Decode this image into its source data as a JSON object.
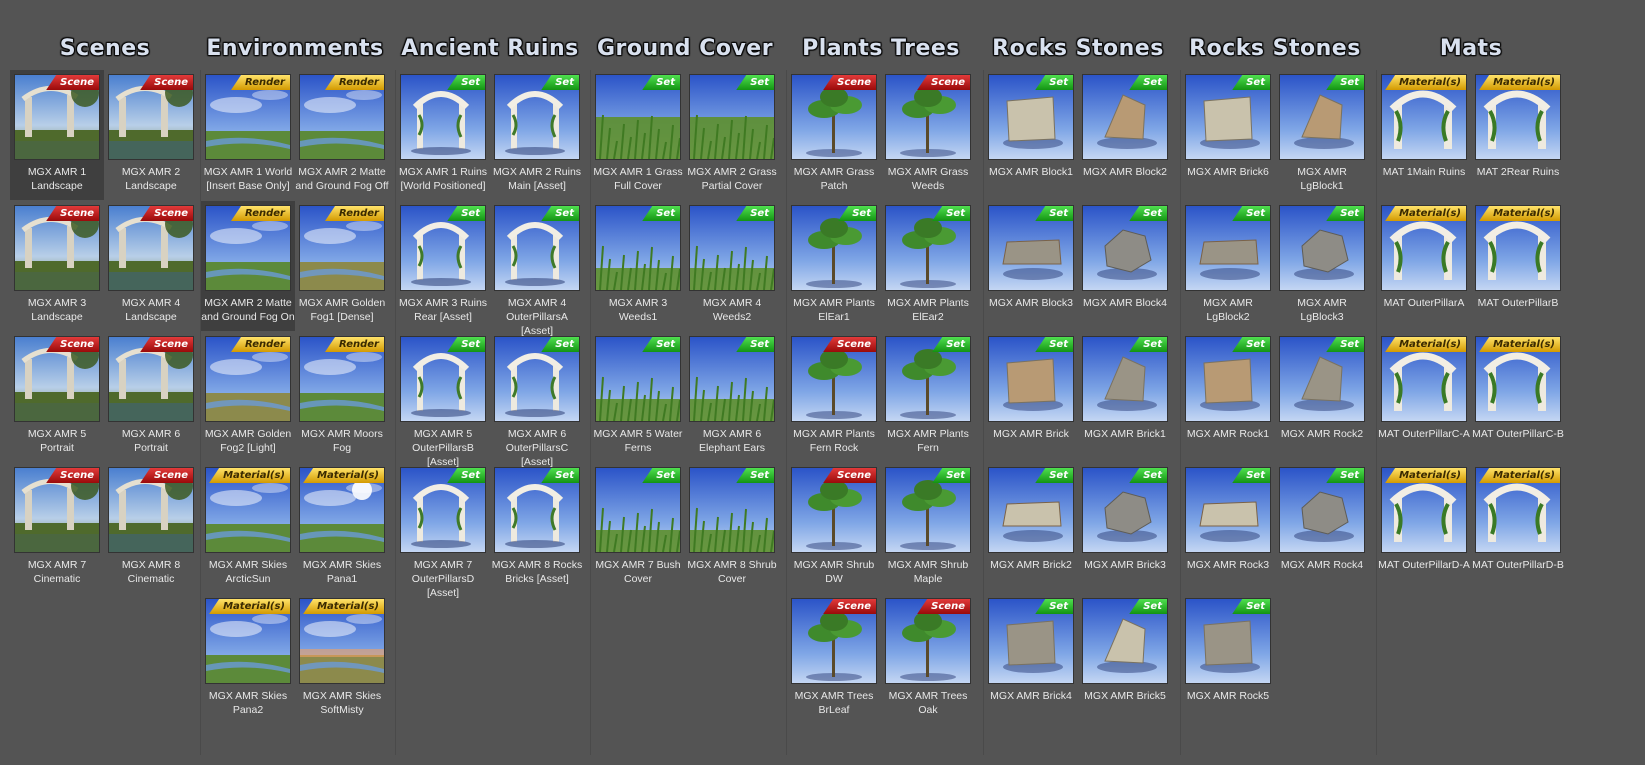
{
  "columns": [
    {
      "title": "Scenes",
      "items": [
        {
          "label": "MGX AMR 1 Landscape",
          "badge": "Scene",
          "kind": "scene",
          "selected": true
        },
        {
          "label": "MGX AMR 2 Landscape",
          "badge": "Scene",
          "kind": "scene"
        },
        {
          "label": "MGX AMR 3 Landscape",
          "badge": "Scene",
          "kind": "scene"
        },
        {
          "label": "MGX AMR 4 Landscape",
          "badge": "Scene",
          "kind": "scene"
        },
        {
          "label": "MGX AMR 5 Portrait",
          "badge": "Scene",
          "kind": "scene"
        },
        {
          "label": "MGX AMR 6 Portrait",
          "badge": "Scene",
          "kind": "scene"
        },
        {
          "label": "MGX AMR 7 Cinematic",
          "badge": "Scene",
          "kind": "scene"
        },
        {
          "label": "MGX AMR 8 Cinematic",
          "badge": "Scene",
          "kind": "scene"
        }
      ]
    },
    {
      "title": "Environments",
      "items": [
        {
          "label": "MGX AMR 1 World [Insert Base Only]",
          "badge": "Render",
          "kind": "render"
        },
        {
          "label": "MGX AMR 2 Matte and Ground Fog Off",
          "badge": "Render",
          "kind": "render"
        },
        {
          "label": "MGX AMR 2 Matte and Ground Fog On",
          "badge": "Render",
          "kind": "render",
          "selected": true
        },
        {
          "label": "MGX AMR Golden Fog1 [Dense]",
          "badge": "Render",
          "kind": "render"
        },
        {
          "label": "MGX AMR Golden Fog2 [Light]",
          "badge": "Render",
          "kind": "render"
        },
        {
          "label": "MGX AMR Moors Fog",
          "badge": "Render",
          "kind": "render"
        },
        {
          "label": "MGX AMR Skies ArcticSun",
          "badge": "Material(s)",
          "kind": "mat"
        },
        {
          "label": "MGX AMR Skies Pana1",
          "badge": "Material(s)",
          "kind": "mat"
        },
        {
          "label": "MGX AMR Skies Pana2",
          "badge": "Material(s)",
          "kind": "mat"
        },
        {
          "label": "MGX AMR Skies SoftMisty",
          "badge": "Material(s)",
          "kind": "mat"
        }
      ]
    },
    {
      "title": "Ancient Ruins",
      "items": [
        {
          "label": "MGX AMR 1 Ruins [World Positioned]",
          "badge": "Set",
          "kind": "set"
        },
        {
          "label": "MGX AMR 2 Ruins Main [Asset]",
          "badge": "Set",
          "kind": "set"
        },
        {
          "label": "MGX AMR 3 Ruins Rear [Asset]",
          "badge": "Set",
          "kind": "set"
        },
        {
          "label": "MGX AMR 4 OuterPillarsA [Asset]",
          "badge": "Set",
          "kind": "set"
        },
        {
          "label": "MGX AMR 5 OuterPillarsB [Asset]",
          "badge": "Set",
          "kind": "set"
        },
        {
          "label": "MGX AMR 6 OuterPillarsC [Asset]",
          "badge": "Set",
          "kind": "set"
        },
        {
          "label": "MGX AMR 7 OuterPillarsD [Asset]",
          "badge": "Set",
          "kind": "set"
        },
        {
          "label": "MGX AMR 8 Rocks Bricks [Asset]",
          "badge": "Set",
          "kind": "set"
        }
      ]
    },
    {
      "title": "Ground Cover",
      "items": [
        {
          "label": "MGX AMR 1 Grass Full Cover",
          "badge": "Set",
          "kind": "set"
        },
        {
          "label": "MGX AMR 2 Grass Partial Cover",
          "badge": "Set",
          "kind": "set"
        },
        {
          "label": "MGX AMR 3 Weeds1",
          "badge": "Set",
          "kind": "set"
        },
        {
          "label": "MGX AMR 4 Weeds2",
          "badge": "Set",
          "kind": "set"
        },
        {
          "label": "MGX AMR 5 Water Ferns",
          "badge": "Set",
          "kind": "set"
        },
        {
          "label": "MGX AMR 6 Elephant Ears",
          "badge": "Set",
          "kind": "set"
        },
        {
          "label": "MGX AMR 7 Bush Cover",
          "badge": "Set",
          "kind": "set"
        },
        {
          "label": "MGX AMR 8 Shrub Cover",
          "badge": "Set",
          "kind": "set"
        }
      ]
    },
    {
      "title": "Plants Trees",
      "items": [
        {
          "label": "MGX AMR Grass Patch",
          "badge": "Scene",
          "kind": "scene"
        },
        {
          "label": "MGX AMR Grass Weeds",
          "badge": "Scene",
          "kind": "scene"
        },
        {
          "label": "MGX AMR Plants ElEar1",
          "badge": "Set",
          "kind": "set"
        },
        {
          "label": "MGX AMR Plants ElEar2",
          "badge": "Set",
          "kind": "set"
        },
        {
          "label": "MGX AMR Plants Fern Rock",
          "badge": "Scene",
          "kind": "scene"
        },
        {
          "label": "MGX AMR Plants Fern",
          "badge": "Set",
          "kind": "set"
        },
        {
          "label": "MGX AMR Shrub DW",
          "badge": "Scene",
          "kind": "scene"
        },
        {
          "label": "MGX AMR Shrub Maple",
          "badge": "Set",
          "kind": "set"
        },
        {
          "label": "MGX AMR Trees BrLeaf",
          "badge": "Scene",
          "kind": "scene"
        },
        {
          "label": "MGX AMR Trees Oak",
          "badge": "Scene",
          "kind": "scene"
        }
      ]
    },
    {
      "title": "Rocks Stones",
      "items": [
        {
          "label": "MGX AMR Block1",
          "badge": "Set",
          "kind": "set"
        },
        {
          "label": "MGX AMR Block2",
          "badge": "Set",
          "kind": "set"
        },
        {
          "label": "MGX AMR Block3",
          "badge": "Set",
          "kind": "set"
        },
        {
          "label": "MGX AMR Block4",
          "badge": "Set",
          "kind": "set"
        },
        {
          "label": "MGX AMR Brick",
          "badge": "Set",
          "kind": "set"
        },
        {
          "label": "MGX AMR Brick1",
          "badge": "Set",
          "kind": "set"
        },
        {
          "label": "MGX AMR Brick2",
          "badge": "Set",
          "kind": "set"
        },
        {
          "label": "MGX AMR Brick3",
          "badge": "Set",
          "kind": "set"
        },
        {
          "label": "MGX AMR Brick4",
          "badge": "Set",
          "kind": "set"
        },
        {
          "label": "MGX AMR Brick5",
          "badge": "Set",
          "kind": "set"
        }
      ]
    },
    {
      "title": "Rocks Stones",
      "items": [
        {
          "label": "MGX AMR Brick6",
          "badge": "Set",
          "kind": "set"
        },
        {
          "label": "MGX AMR LgBlock1",
          "badge": "Set",
          "kind": "set"
        },
        {
          "label": "MGX AMR LgBlock2",
          "badge": "Set",
          "kind": "set"
        },
        {
          "label": "MGX AMR LgBlock3",
          "badge": "Set",
          "kind": "set"
        },
        {
          "label": "MGX AMR Rock1",
          "badge": "Set",
          "kind": "set"
        },
        {
          "label": "MGX AMR Rock2",
          "badge": "Set",
          "kind": "set"
        },
        {
          "label": "MGX AMR Rock3",
          "badge": "Set",
          "kind": "set"
        },
        {
          "label": "MGX AMR Rock4",
          "badge": "Set",
          "kind": "set"
        },
        {
          "label": "MGX AMR Rock5",
          "badge": "Set",
          "kind": "set"
        }
      ]
    },
    {
      "title": "Mats",
      "items": [
        {
          "label": "MAT 1Main Ruins",
          "badge": "Material(s)",
          "kind": "mat"
        },
        {
          "label": "MAT 2Rear Ruins",
          "badge": "Material(s)",
          "kind": "mat"
        },
        {
          "label": "MAT OuterPillarA",
          "badge": "Material(s)",
          "kind": "mat"
        },
        {
          "label": "MAT OuterPillarB",
          "badge": "Material(s)",
          "kind": "mat"
        },
        {
          "label": "MAT OuterPillarC-A",
          "badge": "Material(s)",
          "kind": "mat"
        },
        {
          "label": "MAT OuterPillarC-B",
          "badge": "Material(s)",
          "kind": "mat"
        },
        {
          "label": "MAT OuterPillarD-A",
          "badge": "Material(s)",
          "kind": "mat"
        },
        {
          "label": "MAT OuterPillarD-B",
          "badge": "Material(s)",
          "kind": "mat"
        }
      ]
    }
  ]
}
